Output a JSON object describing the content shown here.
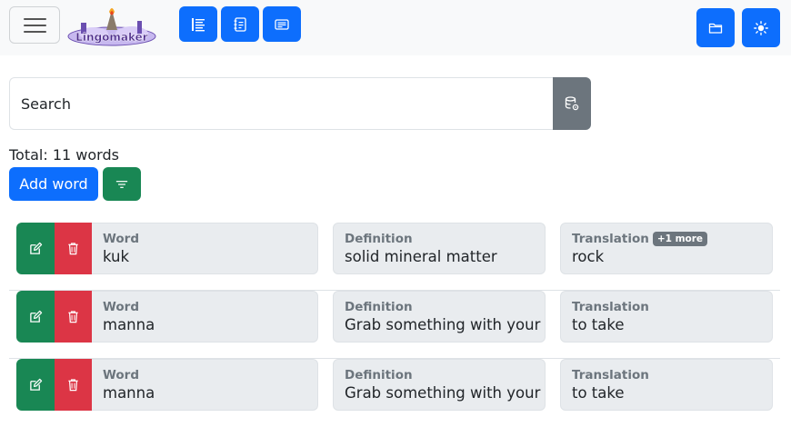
{
  "navbar": {
    "logo_text": "Lingomaker",
    "buttons": [
      {
        "name": "list-view",
        "icon": "list-icon"
      },
      {
        "name": "card-view",
        "icon": "journal-text-icon"
      },
      {
        "name": "flashcard-view",
        "icon": "card-text-icon"
      }
    ],
    "right_buttons": [
      {
        "name": "folder",
        "icon": "folder-icon"
      },
      {
        "name": "theme",
        "icon": "sun-icon"
      }
    ],
    "colors": {
      "primary": "#0d6efd",
      "bar": "#f8f9fa"
    }
  },
  "search": {
    "placeholder": "Search",
    "value": "",
    "button_icon": "database-gear-icon"
  },
  "total_label": "Total: 11 words",
  "actions": {
    "add_label": "Add word",
    "filter_icon": "filter-icon"
  },
  "labels": {
    "word": "Word",
    "definition": "Definition",
    "translation": "Translation"
  },
  "words": [
    {
      "word": "kuk",
      "definition": "solid mineral matter",
      "translation": "rock",
      "translation_badge": "+1 more"
    },
    {
      "word": "manna",
      "definition": "Grab something with your h",
      "translation": "to take",
      "translation_badge": ""
    },
    {
      "word": "manna",
      "definition": "Grab something with your h",
      "translation": "to take",
      "translation_badge": ""
    }
  ],
  "colors": {
    "edit": "#198754",
    "delete": "#dc3545",
    "field_bg": "#e9ecef",
    "secondary": "#6c757d"
  }
}
